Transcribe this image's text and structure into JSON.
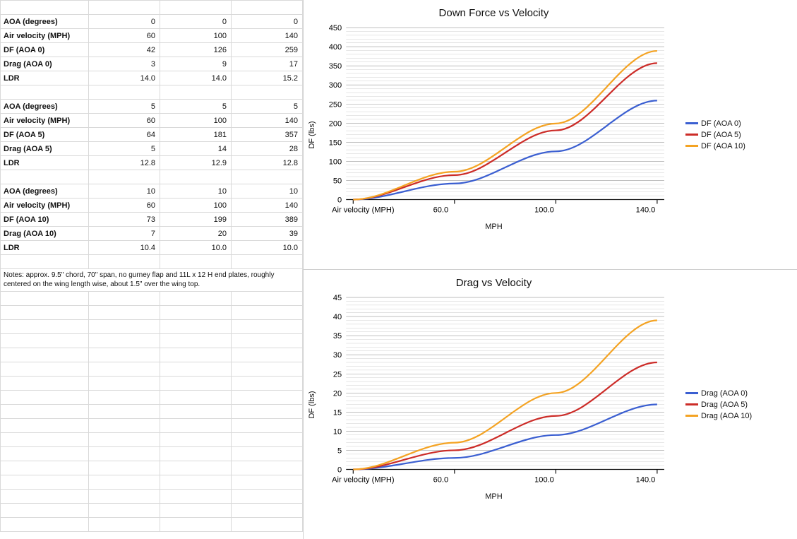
{
  "chart_data": [
    {
      "type": "line",
      "title": "Down Force vs Velocity",
      "ylabel": "DF (lbs)",
      "xlabel": "MPH",
      "categories": [
        "Air velocity (MPH)",
        "60.0",
        "100.0",
        "140.0"
      ],
      "ylim": [
        0,
        450
      ],
      "ystep_major": 50,
      "series": [
        {
          "name": "DF (AOA 0)",
          "color": "blue",
          "values": [
            0,
            42,
            126,
            259
          ]
        },
        {
          "name": "DF (AOA 5)",
          "color": "red",
          "values": [
            0,
            64,
            181,
            357
          ]
        },
        {
          "name": "DF (AOA 10)",
          "color": "orange",
          "values": [
            0,
            73,
            199,
            389
          ]
        }
      ]
    },
    {
      "type": "line",
      "title": "Drag vs Velocity",
      "ylabel": "DF (lbs)",
      "xlabel": "MPH",
      "categories": [
        "Air velocity (MPH)",
        "60.0",
        "100.0",
        "140.0"
      ],
      "ylim": [
        0,
        45
      ],
      "ystep_major": 5,
      "series": [
        {
          "name": "Drag (AOA 0)",
          "color": "blue",
          "values": [
            0,
            3,
            9,
            17
          ]
        },
        {
          "name": "Drag (AOA 5)",
          "color": "red",
          "values": [
            0,
            5,
            14,
            28
          ]
        },
        {
          "name": "Drag (AOA 10)",
          "color": "orange",
          "values": [
            0,
            7,
            20,
            39
          ]
        }
      ]
    }
  ],
  "sheet": {
    "blocks": [
      {
        "rows": [
          {
            "label": "AOA (degrees)",
            "v": [
              "0",
              "0",
              "0"
            ]
          },
          {
            "label": "Air velocity (MPH)",
            "v": [
              "60",
              "100",
              "140"
            ]
          },
          {
            "label": "DF (AOA 0)",
            "v": [
              "42",
              "126",
              "259"
            ]
          },
          {
            "label": "Drag (AOA 0)",
            "v": [
              "3",
              "9",
              "17"
            ]
          },
          {
            "label": "LDR",
            "v": [
              "14.0",
              "14.0",
              "15.2"
            ]
          }
        ]
      },
      {
        "rows": [
          {
            "label": "AOA (degrees)",
            "v": [
              "5",
              "5",
              "5"
            ]
          },
          {
            "label": "Air velocity (MPH)",
            "v": [
              "60",
              "100",
              "140"
            ]
          },
          {
            "label": "DF (AOA 5)",
            "v": [
              "64",
              "181",
              "357"
            ]
          },
          {
            "label": "Drag (AOA 5)",
            "v": [
              "5",
              "14",
              "28"
            ]
          },
          {
            "label": "LDR",
            "v": [
              "12.8",
              "12.9",
              "12.8"
            ]
          }
        ]
      },
      {
        "rows": [
          {
            "label": "AOA (degrees)",
            "v": [
              "10",
              "10",
              "10"
            ]
          },
          {
            "label": "Air velocity (MPH)",
            "v": [
              "60",
              "100",
              "140"
            ]
          },
          {
            "label": "DF (AOA 10)",
            "v": [
              "73",
              "199",
              "389"
            ]
          },
          {
            "label": "Drag (AOA 10)",
            "v": [
              "7",
              "20",
              "39"
            ]
          },
          {
            "label": "LDR",
            "v": [
              "10.4",
              "10.0",
              "10.0"
            ]
          }
        ]
      }
    ],
    "note": "Notes: approx. 9.5\" chord, 70\" span, no gurney flap and 11L x 12 H end plates, roughly centered on the wing length wise, about 1.5\" over the wing top."
  }
}
